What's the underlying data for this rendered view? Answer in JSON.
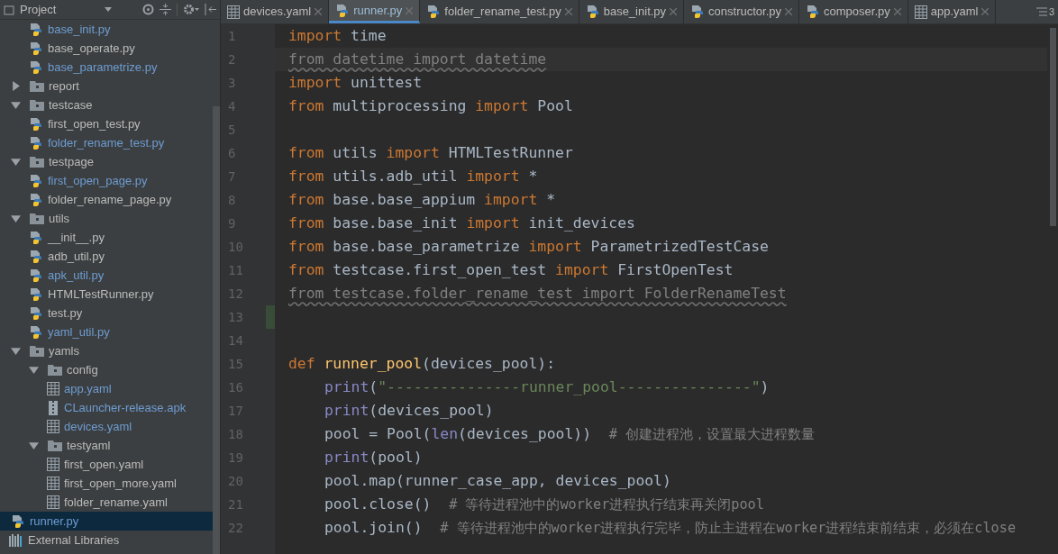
{
  "sidebar": {
    "title": "Project",
    "tree": [
      {
        "kind": "continuation",
        "children": [
          {
            "name": "base_init.py",
            "kind": "python",
            "modified": true,
            "selected": false
          },
          {
            "name": "base_operate.py",
            "kind": "python",
            "modified": false,
            "selected": false
          },
          {
            "name": "base_parametrize.py",
            "kind": "python",
            "modified": true,
            "selected": false
          }
        ]
      },
      {
        "name": "report",
        "kind": "folder",
        "expanded": false,
        "selected": false
      },
      {
        "name": "testcase",
        "kind": "folder",
        "expanded": true,
        "selected": false,
        "children": [
          {
            "name": "first_open_test.py",
            "kind": "python",
            "modified": false,
            "selected": false
          },
          {
            "name": "folder_rename_test.py",
            "kind": "python",
            "modified": true,
            "selected": false
          }
        ]
      },
      {
        "name": "testpage",
        "kind": "folder",
        "expanded": true,
        "selected": false,
        "children": [
          {
            "name": "first_open_page.py",
            "kind": "python",
            "modified": true,
            "selected": false
          },
          {
            "name": "folder_rename_page.py",
            "kind": "python",
            "modified": false,
            "selected": false
          }
        ]
      },
      {
        "name": "utils",
        "kind": "folder",
        "expanded": true,
        "selected": false,
        "children": [
          {
            "name": "__init__.py",
            "kind": "python",
            "modified": false,
            "selected": false
          },
          {
            "name": "adb_util.py",
            "kind": "python",
            "modified": false,
            "selected": false
          },
          {
            "name": "apk_util.py",
            "kind": "python",
            "modified": true,
            "selected": false
          },
          {
            "name": "HTMLTestRunner.py",
            "kind": "python",
            "modified": false,
            "selected": false
          },
          {
            "name": "test.py",
            "kind": "python",
            "modified": false,
            "selected": false
          },
          {
            "name": "yaml_util.py",
            "kind": "python",
            "modified": true,
            "selected": false
          }
        ]
      },
      {
        "name": "yamls",
        "kind": "folder",
        "expanded": true,
        "selected": false,
        "children": [
          {
            "name": "config",
            "kind": "folder",
            "expanded": true,
            "selected": false,
            "children": [
              {
                "name": "app.yaml",
                "kind": "yaml",
                "modified": true,
                "selected": false
              },
              {
                "name": "CLauncher-release.apk",
                "kind": "archive",
                "modified": true,
                "selected": false
              },
              {
                "name": "devices.yaml",
                "kind": "yaml",
                "modified": true,
                "selected": false
              }
            ]
          },
          {
            "name": "testyaml",
            "kind": "folder",
            "expanded": true,
            "selected": false,
            "children": [
              {
                "name": "first_open.yaml",
                "kind": "yaml",
                "modified": false,
                "selected": false
              },
              {
                "name": "first_open_more.yaml",
                "kind": "yaml",
                "modified": false,
                "selected": false
              },
              {
                "name": "folder_rename.yaml",
                "kind": "yaml",
                "modified": false,
                "selected": false
              }
            ]
          }
        ]
      },
      {
        "name": "runner.py",
        "kind": "python",
        "modified": true,
        "selected": true
      },
      {
        "name": "External Libraries",
        "kind": "library",
        "selected": false
      }
    ]
  },
  "tabs": [
    {
      "label": "devices.yaml",
      "kind": "yaml",
      "selected": false
    },
    {
      "label": "runner.py",
      "kind": "python",
      "selected": true
    },
    {
      "label": "folder_rename_test.py",
      "kind": "python",
      "selected": false
    },
    {
      "label": "base_init.py",
      "kind": "python",
      "selected": false
    },
    {
      "label": "constructor.py",
      "kind": "python",
      "selected": false
    },
    {
      "label": "composer.py",
      "kind": "python",
      "selected": false
    },
    {
      "label": "app.yaml",
      "kind": "yaml",
      "selected": false
    }
  ],
  "hidden_tabs_count": "3",
  "editor": {
    "lines": [
      {
        "number": "1",
        "tokens": [
          {
            "kind": "kw",
            "text": "import"
          },
          {
            "kind": "plain",
            "text": " time"
          }
        ]
      },
      {
        "number": "2",
        "current": true,
        "tokens": [
          {
            "kind": "unused",
            "text": "from datetime import datetime"
          }
        ]
      },
      {
        "number": "3",
        "tokens": [
          {
            "kind": "kw",
            "text": "import"
          },
          {
            "kind": "plain",
            "text": " unittest"
          }
        ]
      },
      {
        "number": "4",
        "tokens": [
          {
            "kind": "kw",
            "text": "from"
          },
          {
            "kind": "plain",
            "text": " multiprocessing "
          },
          {
            "kind": "kw",
            "text": "import"
          },
          {
            "kind": "plain",
            "text": " Pool"
          }
        ]
      },
      {
        "number": "5"
      },
      {
        "number": "6",
        "tokens": [
          {
            "kind": "kw",
            "text": "from"
          },
          {
            "kind": "plain",
            "text": " utils "
          },
          {
            "kind": "kw",
            "text": "import"
          },
          {
            "kind": "plain",
            "text": " HTMLTestRunner"
          }
        ]
      },
      {
        "number": "7",
        "tokens": [
          {
            "kind": "kw",
            "text": "from"
          },
          {
            "kind": "plain",
            "text": " utils.adb_util "
          },
          {
            "kind": "kw",
            "text": "import"
          },
          {
            "kind": "plain",
            "text": " *"
          }
        ]
      },
      {
        "number": "8",
        "tokens": [
          {
            "kind": "kw",
            "text": "from"
          },
          {
            "kind": "plain",
            "text": " base.base_appium "
          },
          {
            "kind": "kw",
            "text": "import"
          },
          {
            "kind": "plain",
            "text": " *"
          }
        ]
      },
      {
        "number": "9",
        "tokens": [
          {
            "kind": "kw",
            "text": "from"
          },
          {
            "kind": "plain",
            "text": " base.base_init "
          },
          {
            "kind": "kw",
            "text": "import"
          },
          {
            "kind": "plain",
            "text": " init_devices"
          }
        ]
      },
      {
        "number": "10",
        "tokens": [
          {
            "kind": "kw",
            "text": "from"
          },
          {
            "kind": "plain",
            "text": " base.base_parametrize "
          },
          {
            "kind": "kw",
            "text": "import"
          },
          {
            "kind": "plain",
            "text": " ParametrizedTestCase"
          }
        ]
      },
      {
        "number": "11",
        "tokens": [
          {
            "kind": "kw",
            "text": "from"
          },
          {
            "kind": "plain",
            "text": " testcase.first_open_test "
          },
          {
            "kind": "kw",
            "text": "import"
          },
          {
            "kind": "plain",
            "text": " FirstOpenTest"
          }
        ]
      },
      {
        "number": "12",
        "tokens": [
          {
            "kind": "unused",
            "text": "from testcase.folder_rename_test import FolderRenameTest"
          }
        ]
      },
      {
        "number": "13",
        "changed": true
      },
      {
        "number": "14"
      },
      {
        "number": "15",
        "tokens": [
          {
            "kind": "kw",
            "text": "def "
          },
          {
            "kind": "fn",
            "text": "runner_pool"
          },
          {
            "kind": "plain",
            "text": "(devices_pool):"
          }
        ]
      },
      {
        "number": "16",
        "indented": true,
        "tokens": [
          {
            "kind": "builtin",
            "text": "print"
          },
          {
            "kind": "plain",
            "text": "("
          },
          {
            "kind": "str",
            "text": "\"---------------runner_pool---------------\""
          },
          {
            "kind": "plain",
            "text": ")"
          }
        ]
      },
      {
        "number": "17",
        "indented": true,
        "tokens": [
          {
            "kind": "builtin",
            "text": "print"
          },
          {
            "kind": "plain",
            "text": "(devices_pool)"
          }
        ]
      },
      {
        "number": "18",
        "indented": true,
        "tokens": [
          {
            "kind": "plain",
            "text": "pool = Pool("
          },
          {
            "kind": "builtin",
            "text": "len"
          },
          {
            "kind": "plain",
            "text": "(devices_pool))  "
          },
          {
            "kind": "comment",
            "text": "# 创建进程池，设置最大进程数量"
          }
        ]
      },
      {
        "number": "19",
        "indented": true,
        "tokens": [
          {
            "kind": "builtin",
            "text": "print"
          },
          {
            "kind": "plain",
            "text": "(pool)"
          }
        ]
      },
      {
        "number": "20",
        "indented": true,
        "tokens": [
          {
            "kind": "plain",
            "text": "pool.map(runner_case_app, devices_pool)"
          }
        ]
      },
      {
        "number": "21",
        "indented": true,
        "tokens": [
          {
            "kind": "plain",
            "text": "pool.close()  "
          },
          {
            "kind": "comment",
            "text": "# 等待进程池中的worker进程执行结束再关闭pool"
          }
        ]
      },
      {
        "number": "22",
        "indented": true,
        "tokens": [
          {
            "kind": "plain",
            "text": "pool.join()  "
          },
          {
            "kind": "comment",
            "text": "# 等待进程池中的worker进程执行完毕，防止主进程在worker进程结束前结束，必须在close"
          }
        ]
      }
    ]
  }
}
